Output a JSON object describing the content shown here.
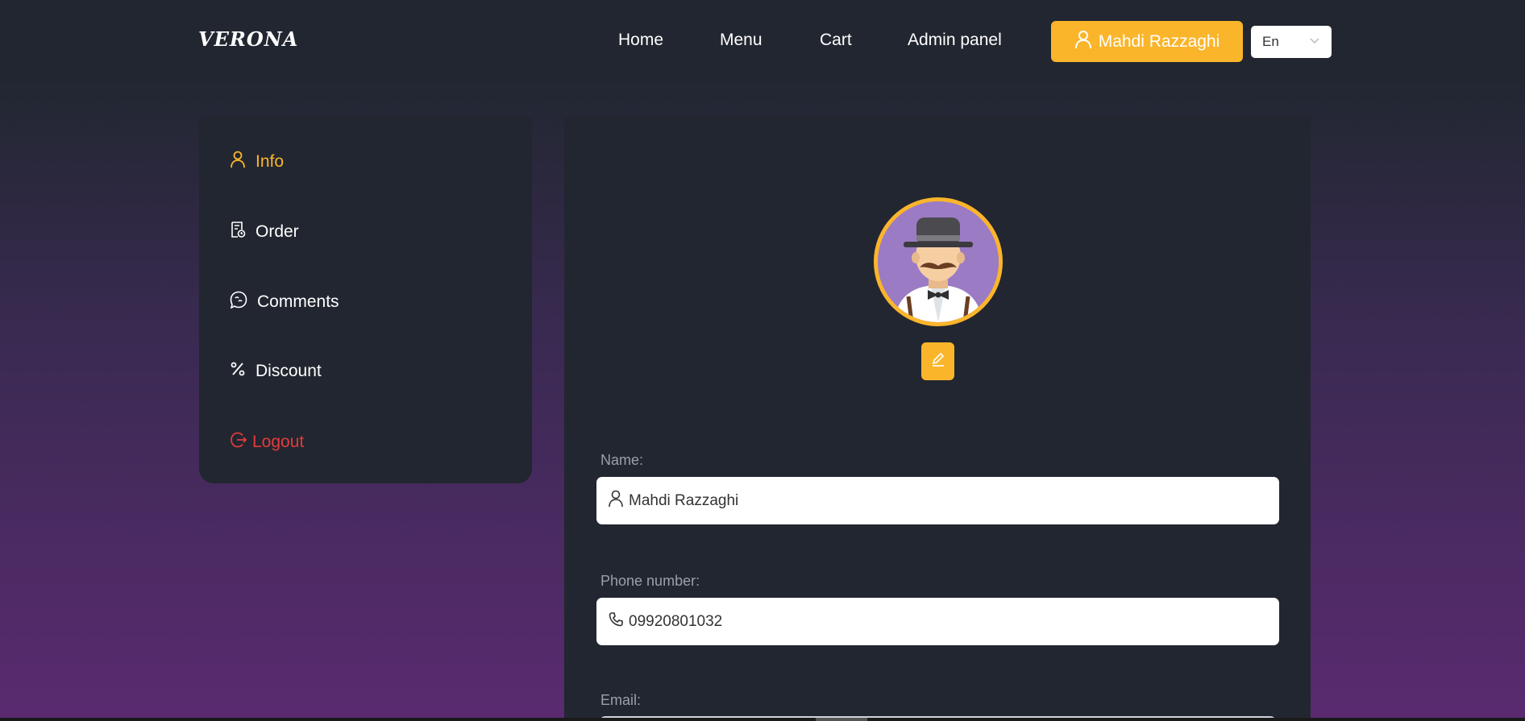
{
  "header": {
    "logo": "VERONA",
    "nav": {
      "home": "Home",
      "menu": "Menu",
      "cart": "Cart",
      "admin": "Admin panel"
    },
    "user_button": "Mahdi Razzaghi",
    "language": "En"
  },
  "sidebar": {
    "items": [
      {
        "label": "Info",
        "icon": "user-icon",
        "active": true
      },
      {
        "label": "Order",
        "icon": "receipt-icon"
      },
      {
        "label": "Comments",
        "icon": "chat-icon"
      },
      {
        "label": "Discount",
        "icon": "percent-icon"
      },
      {
        "label": "Logout",
        "icon": "logout-icon"
      }
    ]
  },
  "profile": {
    "avatar_icon": "mustache-man-avatar",
    "edit_icon": "pencil-icon",
    "name_label": "Name:",
    "name_value": "Mahdi Razzaghi",
    "phone_label": "Phone number:",
    "phone_value": "09920801032",
    "email_label": "Email:"
  },
  "colors": {
    "accent": "#fbb52b",
    "danger": "#e43b3b",
    "panel": "#222630"
  }
}
